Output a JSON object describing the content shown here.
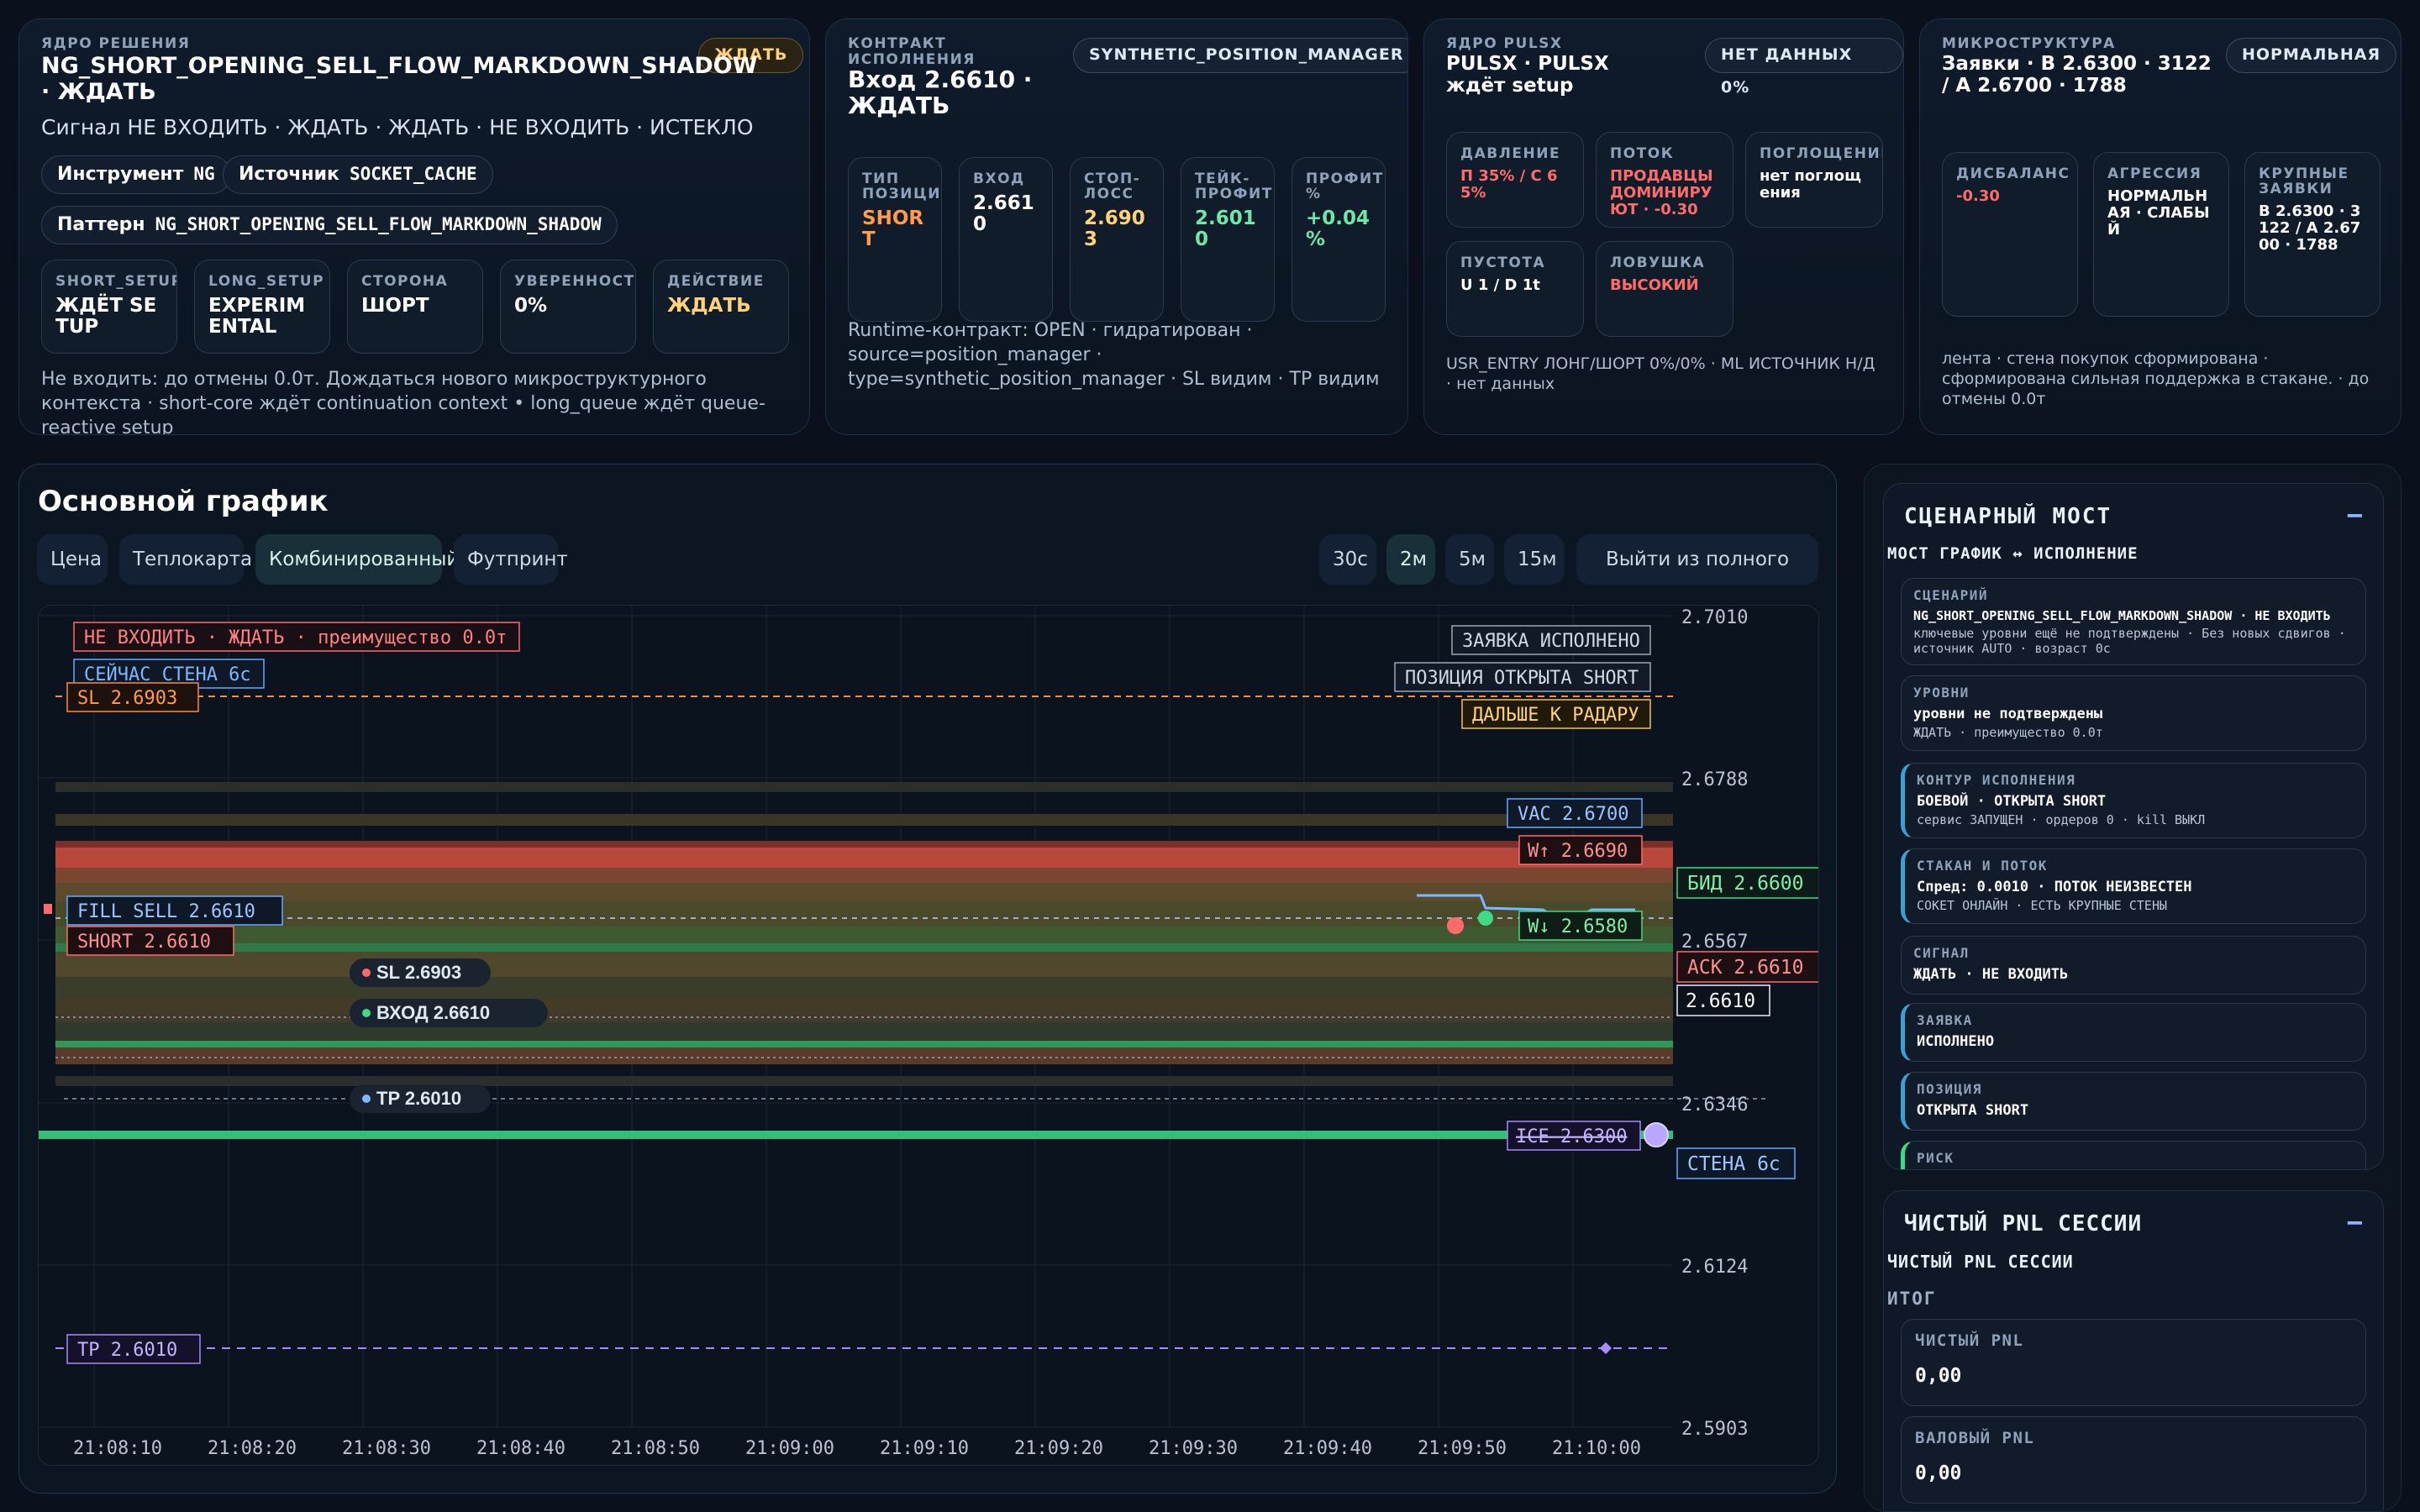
{
  "core": {
    "label": "ЯДРО РЕШЕНИЯ",
    "badge": "ЖДАТЬ",
    "title_line1": "NG_SHORT_OPENING_SELL_FLOW_MARKDOWN_SHADOW",
    "title_line2": "· ЖДАТЬ",
    "signal": "Сигнал НЕ ВХОДИТЬ · ЖДАТЬ · ЖДАТЬ · НЕ ВХОДИТЬ · ИСТЕКЛО",
    "instrument_label": "Инструмент",
    "instrument_value": "NG",
    "source_label": "Источник",
    "source_value": "SOCKET_CACHE",
    "pattern_label": "Паттерн",
    "pattern_value": "NG_SHORT_OPENING_SELL_FLOW_MARKDOWN_SHADOW",
    "cells": [
      {
        "label": "SHORT_SETUP",
        "value": "ЖДЁТ SETUP"
      },
      {
        "label": "LONG_SETUP",
        "value": "EXPERIMENTAL"
      },
      {
        "label": "СТОРОНА",
        "value": "ШОРТ"
      },
      {
        "label": "УВЕРЕННОСТЬ",
        "value": "0%"
      },
      {
        "label": "ДЕЙСТВИЕ",
        "value": "ЖДАТЬ"
      }
    ],
    "note": "Не входить: до отмены 0.0т. Дождаться нового микроструктурного контекста · short-core ждёт continuation context • long_queue ждёт queue-reactive setup"
  },
  "contract": {
    "label": "КОНТРАКТ ИСПОЛНЕНИЯ",
    "badge": "SYNTHETIC_POSITION_MANAGER",
    "title": "Вход 2.6610 · ЖДАТЬ",
    "cells": [
      {
        "label": "ТИП ПОЗИЦИИ",
        "value": "SHORT"
      },
      {
        "label": "ВХОД",
        "value": "2.6610"
      },
      {
        "label": "СТОП-ЛОСС",
        "value": "2.6903"
      },
      {
        "label": "ТЕЙК-ПРОФИТ",
        "value": "2.6010"
      },
      {
        "label": "ПРОФИТ %",
        "value": "+0.04 %"
      }
    ],
    "note": "Runtime-контракт: OPEN · гидратирован · source=position_manager · type=synthetic_position_manager · SL видим · TP видим"
  },
  "pulsx": {
    "label": "ЯДРО PULSX",
    "badge": "НЕТ ДАННЫХ 0%",
    "title": "PULSX · PULSX ждёт setup",
    "cells": [
      {
        "label": "ДАВЛЕНИЕ",
        "value": "П 35% / С 65%"
      },
      {
        "label": "ПОТОК",
        "value": "ПРОДАВЦЫ ДОМИНИРУЮТ · -0.30"
      },
      {
        "label": "ПОГЛОЩЕНИЕ",
        "value": "нет поглощения"
      },
      {
        "label": "ПУСТОТА",
        "value": "U 1 / D 1t"
      },
      {
        "label": "ЛОВУШКА",
        "value": "ВЫСОКИЙ"
      }
    ],
    "note": "USR_ENTRY ЛОНГ/ШОРТ 0%/0% · ML ИСТОЧНИК Н/Д · нет данных"
  },
  "micro": {
    "label": "МИКРОСТРУКТУРА",
    "badge": "НОРМАЛЬНАЯ",
    "title": "Заявки · В 2.6300 · 3122 / А 2.6700 · 1788",
    "cells": [
      {
        "label": "ДИСБАЛАНС",
        "value": "-0.30"
      },
      {
        "label": "АГРЕССИЯ",
        "value": "НОРМАЛЬНАЯ · СЛАБЫЙ"
      },
      {
        "label": "КРУПНЫЕ ЗАЯВКИ",
        "value": "В 2.6300 · 3122 / А 2.6700 · 1788"
      }
    ],
    "note": "лента · стена покупок сформирована · сформирована сильная поддержка в стакане. · до отмены 0.0т"
  },
  "chart": {
    "title": "Основной график",
    "view_tabs": [
      "Цена",
      "Теплокарта",
      "Комбинированный",
      "Футпринт"
    ],
    "active_view": "Комбинированный",
    "intervals": [
      "30с",
      "2м",
      "5м",
      "15м"
    ],
    "active_interval": "2м",
    "fullscreen_label": "Выйти из полного экрана",
    "y_ticks": [
      "2.7010",
      "2.6788",
      "2.6567",
      "2.6346",
      "2.6124",
      "2.5903"
    ],
    "x_ticks": [
      "21:08:10",
      "21:08:20",
      "21:08:30",
      "21:08:40",
      "21:08:50",
      "21:09:00",
      "21:09:10",
      "21:09:20",
      "21:09:30",
      "21:09:40",
      "21:09:50",
      "21:10:00"
    ],
    "annotations": {
      "status": "НЕ ВХОДИТЬ · ЖДАТЬ · преимущество 0.0т",
      "wall_now": "СЕЙЧАС СТЕНА 6с",
      "sl_box": "SL 2.6903",
      "order_done": "ЗАЯВКА ИСПОЛНЕНО",
      "pos_open": "ПОЗИЦИЯ ОТКРЫТА SHORT",
      "radar": "ДАЛЬШЕ К РАДАРУ",
      "vac": "VAC 2.6700",
      "w_up": "W↑ 2.6690",
      "w_down": "W↓ 2.6580",
      "fill_sell": "FILL SELL 2.6610",
      "short_box": "SHORT 2.6610",
      "sl_pill": "SL 2.6903",
      "entry_pill": "ВХОД 2.6610",
      "tp_pill": "TP 2.6010",
      "ice": "ICE 2.6300",
      "tp_box": "TP 2.6010",
      "bid": "БИД 2.6600",
      "ask": "АСК 2.6610",
      "last": "2.6610",
      "wall": "СТЕНА 6с"
    },
    "colors": {
      "sl": "#ff8a3d",
      "short": "#ff5c5c",
      "fill": "#6aa7ff",
      "tp": "#a78bfa",
      "bid": "#3ddc84",
      "ice": "#c4b5fd"
    }
  },
  "bridge": {
    "title": "СЦЕНАРНЫЙ МОСТ",
    "collapse": "−",
    "subtitle": "МОСТ ГРАФИК ↔ ИСПОЛНЕНИЕ",
    "sections": [
      {
        "title": "СЦЕНАРИЙ",
        "value": "NG_SHORT_OPENING_SELL_FLOW_MARKDOWN_SHADOW · НЕ ВХОДИТЬ",
        "sub": "ключевые уровни ещё не подтверждены · Без новых сдвигов · источник AUTO · возраст 0с"
      },
      {
        "title": "УРОВНИ",
        "value": "уровни не подтверждены",
        "sub": "ЖДАТЬ · преимущество 0.0т"
      },
      {
        "title": "КОНТУР ИСПОЛНЕНИЯ",
        "value": "БОЕВОЙ · ОТКРЫТА SHORT",
        "sub": "сервис ЗАПУЩЕН · ордеров 0 · kill ВЫКЛ"
      },
      {
        "title": "СТАКАН И ПОТОК",
        "value": "Спред: 0.0010 · ПОТОК НЕИЗВЕСТЕН",
        "sub": "СОКЕТ ОНЛАЙН · ЕСТЬ КРУПНЫЕ СТЕНЫ"
      },
      {
        "title": "СИГНАЛ",
        "value": "ЖДАТЬ · НЕ ВХОДИТЬ",
        "sub": ""
      },
      {
        "title": "ЗАЯВКА",
        "value": "ИСПОЛНЕНО",
        "sub": ""
      },
      {
        "title": "ПОЗИЦИЯ",
        "value": "ОТКРЫТА SHORT",
        "sub": ""
      },
      {
        "title": "РИСК",
        "value": "",
        "sub": ""
      }
    ]
  },
  "pnl": {
    "title": "ЧИСТЫЙ PNL СЕССИИ",
    "collapse": "−",
    "subtitle": "ЧИСТЫЙ PNL СЕССИИ",
    "total_label": "ИТОГ",
    "net_label": "ЧИСТЫЙ PNL",
    "net_value": "0,00",
    "gross_label": "ВАЛОВЫЙ PNL",
    "gross_value": "0,00"
  }
}
